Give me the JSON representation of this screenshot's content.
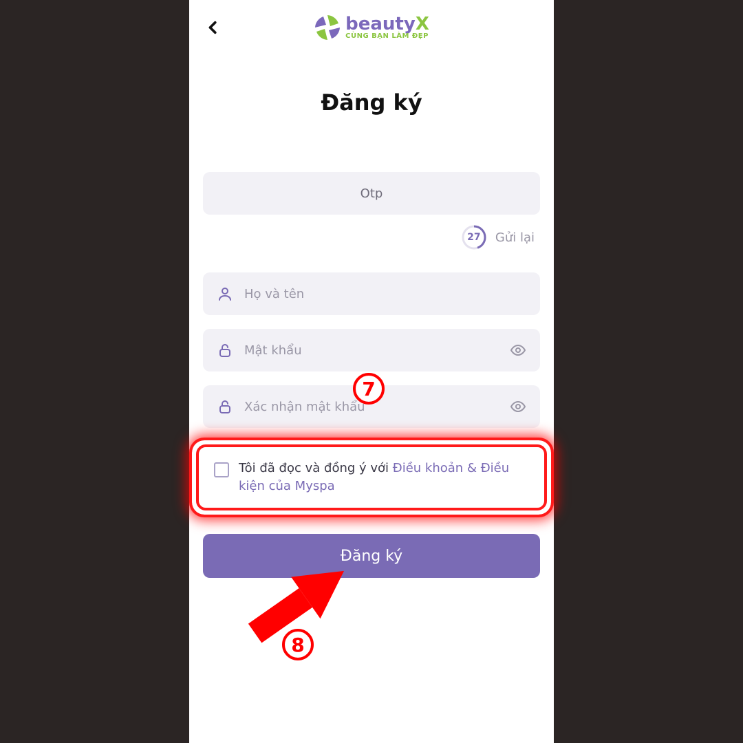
{
  "brand": {
    "name_left": "beauty",
    "name_right": "X",
    "tagline": "CÙNG BẠN LÀM ĐẸP"
  },
  "title": "Đăng ký",
  "otp": {
    "placeholder": "Otp",
    "countdown": "27",
    "resend": "Gửi lại"
  },
  "fullname": {
    "placeholder": "Họ và tên"
  },
  "password": {
    "placeholder": "Mật khẩu"
  },
  "confirm": {
    "placeholder": "Xác nhận mật khẩu"
  },
  "terms": {
    "prefix": "Tôi đã đọc và đồng ý với ",
    "link": "Điều khoản & Điều kiện của Myspa"
  },
  "submit": "Đăng ký",
  "annotations": {
    "step7": "7",
    "step8": "8"
  },
  "colors": {
    "accent": "#7a6bb5",
    "annotation": "#ff0000",
    "green": "#8bc540"
  }
}
